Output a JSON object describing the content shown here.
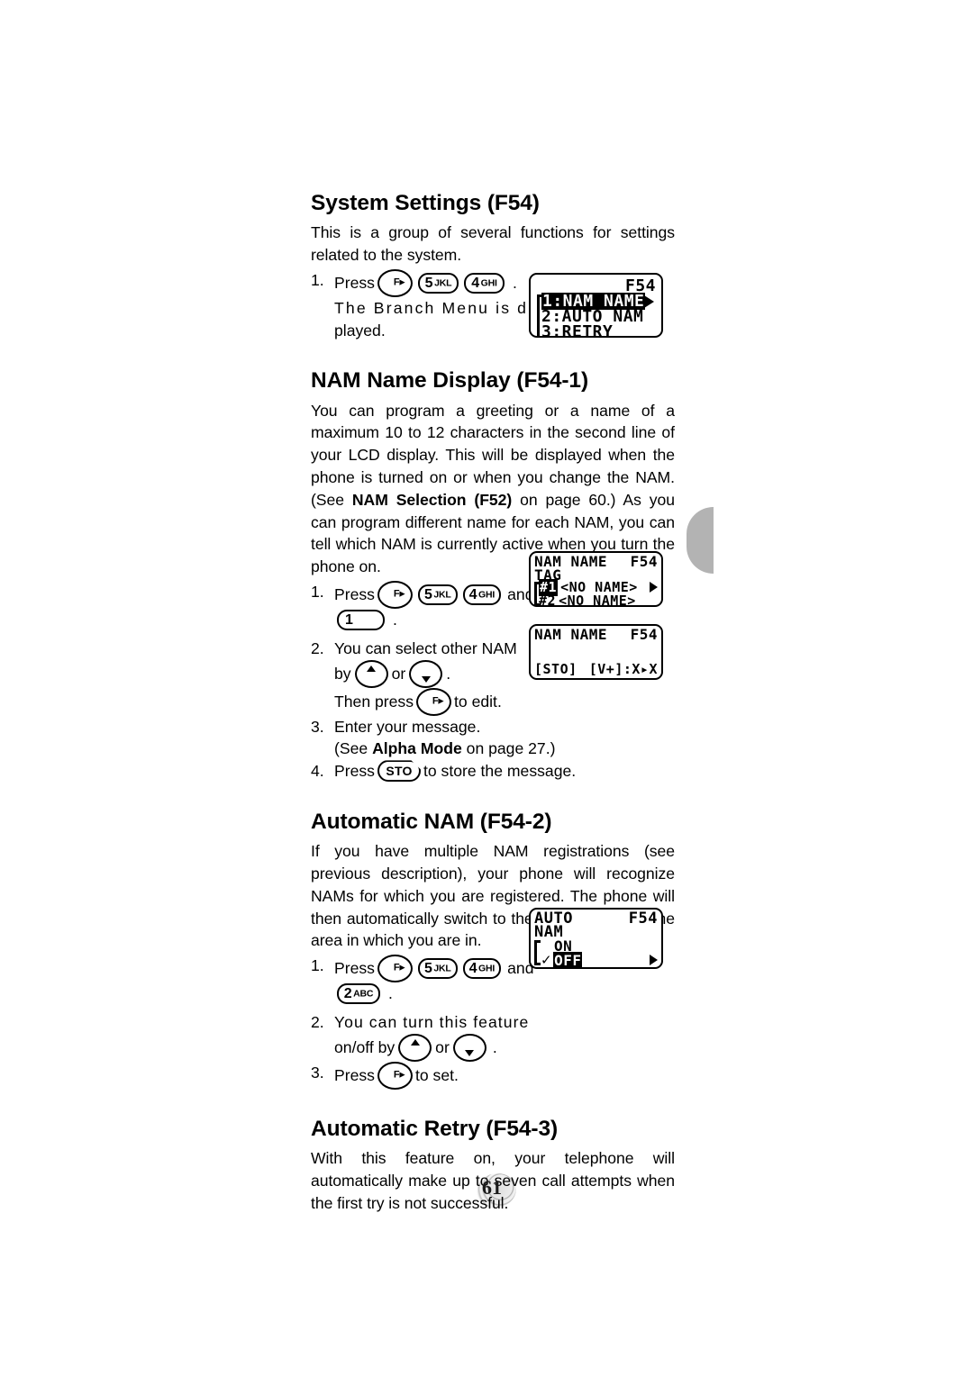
{
  "page": {
    "number": "61"
  },
  "sections": [
    {
      "id": "system-settings",
      "title": "System Settings (F54)",
      "body": "This is a group of several functions for settings related to the system.",
      "steps": [
        {
          "num": "1.",
          "pre": "Press",
          "post": ".",
          "keys": [
            "F-key",
            "5 JKL",
            "4 GHI"
          ]
        },
        {
          "num": "",
          "text_line_1": "The  Branch  Menu  is  dis-",
          "text_line_2": "played."
        }
      ]
    },
    {
      "id": "nam-name-display",
      "title": "NAM Name Display (F54-1)",
      "body_part_1": "You can program a greeting or a name of a maximum 10 to 12 characters in the second line of your LCD display. This will be displayed when the phone is turned on or when you change the NAM. (See ",
      "body_bold_1": "NAM Selection (F52)",
      "body_part_2": " on page 60.) As you can program different name for each NAM, you can tell which NAM is currently active when you turn the phone on.",
      "steps": [
        {
          "num": "1.",
          "pre": "Press",
          "mid": "and",
          "post": ".",
          "keys": [
            "F-key",
            "5 JKL",
            "4 GHI",
            "1"
          ]
        },
        {
          "num": "2.",
          "line1": "You can select other NAM",
          "line2_pre": "by",
          "line2_mid": "or",
          "line2_post": ".",
          "line3_pre": "Then press",
          "line3_post": "to edit."
        },
        {
          "num": "3.",
          "line1": "Enter your message.",
          "line2_pre": "(See ",
          "line2_bold": "Alpha Mode",
          "line2_post": " on page 27.)"
        },
        {
          "num": "4.",
          "pre": "Press",
          "post": "to store the message.",
          "keys": [
            "STO"
          ]
        }
      ]
    },
    {
      "id": "automatic-nam",
      "title": "Automatic NAM (F54-2)",
      "body": "If you have multiple NAM registrations (see previous description), your phone will recognize NAMs for which you are registered. The phone will then automatically switch to the proper NAM for the area in which you are in.",
      "steps": [
        {
          "num": "1.",
          "pre": "Press",
          "mid": "and",
          "post": ".",
          "keys": [
            "F-key",
            "5 JKL",
            "4 GHI",
            "2 ABC"
          ]
        },
        {
          "num": "2.",
          "line1": "You  can  turn  this  feature",
          "line2_pre": "on/off by",
          "line2_mid": "or",
          "line2_post": "."
        },
        {
          "num": "3.",
          "pre": "Press",
          "post": "to set."
        }
      ]
    },
    {
      "id": "automatic-retry",
      "title": "Automatic Retry (F54-3)",
      "body": "With this feature on, your telephone will automatically make up to seven call attempts when the first try is not successful."
    }
  ],
  "keys": {
    "f": "F",
    "f_arrow": "▸",
    "five": "5",
    "five_letters": "JKL",
    "four": "4",
    "four_letters": "GHI",
    "one": "1",
    "two": "2",
    "two_letters": "ABC",
    "sto": "STO"
  },
  "lcds": {
    "branch_menu": {
      "title_right": "F54",
      "items": [
        {
          "label": "1:NAM NAME",
          "selected": true
        },
        {
          "label": "2:AUTO NAM",
          "selected": false
        },
        {
          "label": "3:RETRY",
          "selected": false
        }
      ]
    },
    "nam_name_tag": {
      "title_left": "NAM NAME",
      "title_right": "F54",
      "subtitle": "TAG",
      "items": [
        {
          "tag": "#1",
          "value": "<NO NAME>",
          "selected": true
        },
        {
          "tag": "#2",
          "value": "<NO NAME>",
          "selected": false
        }
      ]
    },
    "nam_name_edit": {
      "title_left": "NAM NAME",
      "title_right": "F54",
      "softkey_left": "[STO]",
      "softkey_right": "[V+]:X▸X"
    },
    "auto_nam": {
      "title_left_line1": "AUTO",
      "title_left_line2": "NAM",
      "title_right": "F54",
      "options": [
        {
          "label": "ON",
          "selected": false,
          "checked": false
        },
        {
          "label": "OFF",
          "selected": true,
          "checked": true
        }
      ],
      "check_glyph": "✓"
    }
  }
}
